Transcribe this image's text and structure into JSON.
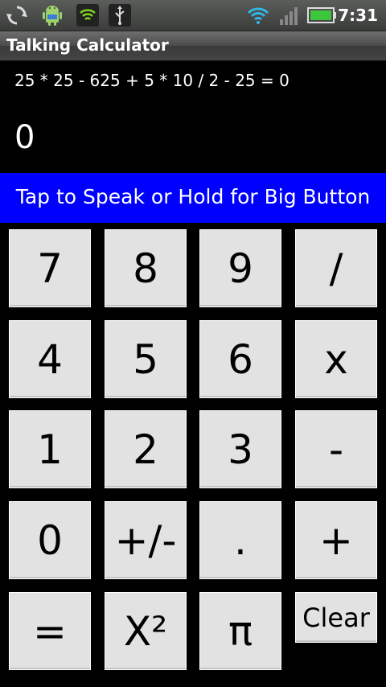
{
  "status_bar": {
    "time": "7:31",
    "icons": [
      "sync-icon",
      "android-icon",
      "shield-icon",
      "usb-icon",
      "wifi-icon",
      "signal-icon",
      "battery-icon"
    ]
  },
  "app": {
    "title": "Talking Calculator"
  },
  "display": {
    "expression": "25 * 25 - 625 + 5 * 10 / 2 - 25 = 0",
    "result": "0"
  },
  "speak_bar": {
    "label": "Tap to Speak or Hold for Big Button"
  },
  "keys": [
    {
      "name": "key-7",
      "label": "7"
    },
    {
      "name": "key-8",
      "label": "8"
    },
    {
      "name": "key-9",
      "label": "9"
    },
    {
      "name": "key-divide",
      "label": "/"
    },
    {
      "name": "key-4",
      "label": "4"
    },
    {
      "name": "key-5",
      "label": "5"
    },
    {
      "name": "key-6",
      "label": "6"
    },
    {
      "name": "key-multiply",
      "label": "x"
    },
    {
      "name": "key-1",
      "label": "1"
    },
    {
      "name": "key-2",
      "label": "2"
    },
    {
      "name": "key-3",
      "label": "3"
    },
    {
      "name": "key-subtract",
      "label": "-"
    },
    {
      "name": "key-0",
      "label": "0"
    },
    {
      "name": "key-negate",
      "label": "+/-"
    },
    {
      "name": "key-decimal",
      "label": "."
    },
    {
      "name": "key-add",
      "label": "+"
    },
    {
      "name": "key-equals",
      "label": "="
    },
    {
      "name": "key-square",
      "label": "X²"
    },
    {
      "name": "key-pi",
      "label": "π"
    },
    {
      "name": "key-clear",
      "label": "Clear"
    }
  ]
}
